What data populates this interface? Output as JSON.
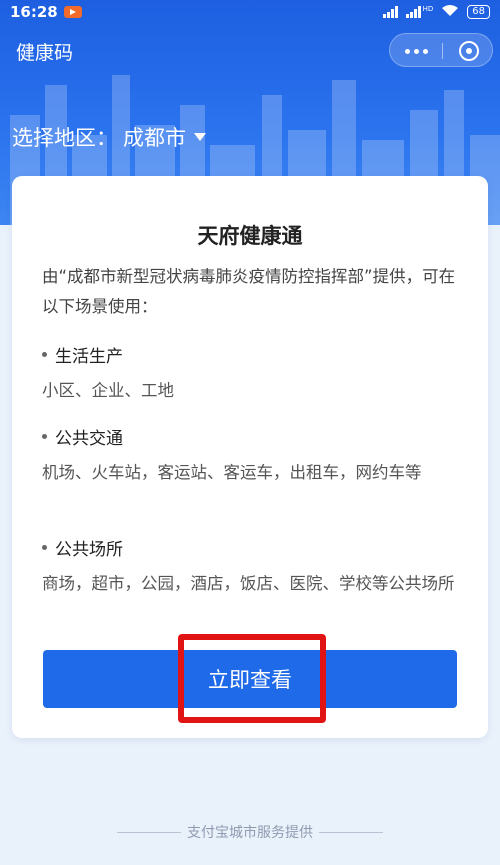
{
  "status_bar": {
    "time": "16:28",
    "network_label": "HD",
    "battery": "68"
  },
  "header": {
    "title": "健康码",
    "region_label": "选择地区：",
    "region_value": "成都市"
  },
  "card": {
    "title": "天府健康通",
    "intro": "由“成都市新型冠状病毒肺炎疫情防控指挥部”提供，可在以下场景使用：",
    "sections": [
      {
        "heading": "生活生产",
        "body": "小区、企业、工地"
      },
      {
        "heading": "公共交通",
        "body": "机场、火车站，客运站、客运车，出租车，网约车等"
      },
      {
        "heading": "公共场所",
        "body": "商场，超市，公园，酒店，饭店、医院、学校等公共场所"
      }
    ],
    "button_label": "立即查看"
  },
  "footer": {
    "text": "支付宝城市服务提供"
  },
  "colors": {
    "primary": "#1f6ae9",
    "header_top": "#1d5fe0",
    "highlight": "#e11414",
    "background": "#e9f1fb"
  },
  "icons": [
    "app-notification-icon",
    "signal-icon",
    "wifi-icon",
    "battery-icon",
    "more-icon",
    "close-mini-program-icon",
    "dropdown-caret-icon"
  ]
}
